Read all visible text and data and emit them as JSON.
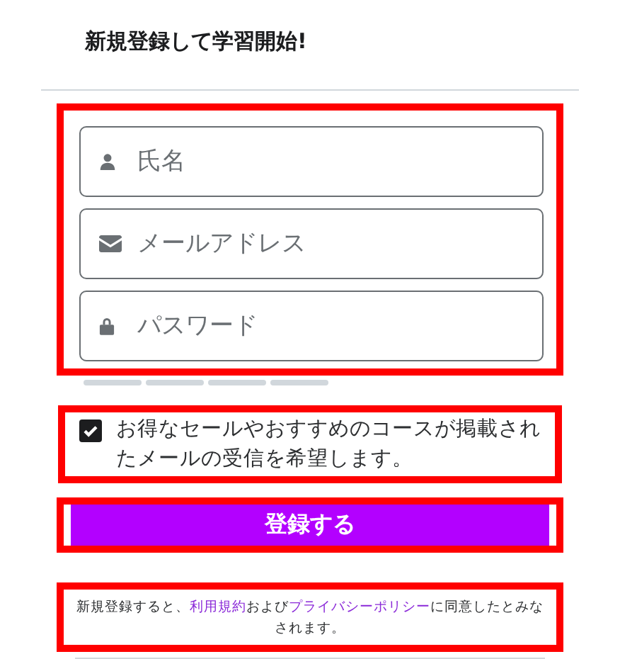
{
  "heading": "新規登録して学習開始!",
  "fields": [
    {
      "kind": "name",
      "placeholder": "氏名"
    },
    {
      "kind": "email",
      "placeholder": "メールアドレス"
    },
    {
      "kind": "password",
      "placeholder": "パスワード"
    }
  ],
  "newsletter": {
    "checked": true,
    "label": "お得なセールやおすすめのコースが掲載されたメールの受信を希望します。"
  },
  "submit_button": "登録する",
  "terms": [
    {
      "kind": "text",
      "text": "新規登録すると、"
    },
    {
      "kind": "link",
      "text": "利用規約"
    },
    {
      "kind": "text",
      "text": "および"
    },
    {
      "kind": "link",
      "text": "プライバシーポリシー"
    },
    {
      "kind": "text",
      "text": "に同意したとみなされます。"
    }
  ]
}
